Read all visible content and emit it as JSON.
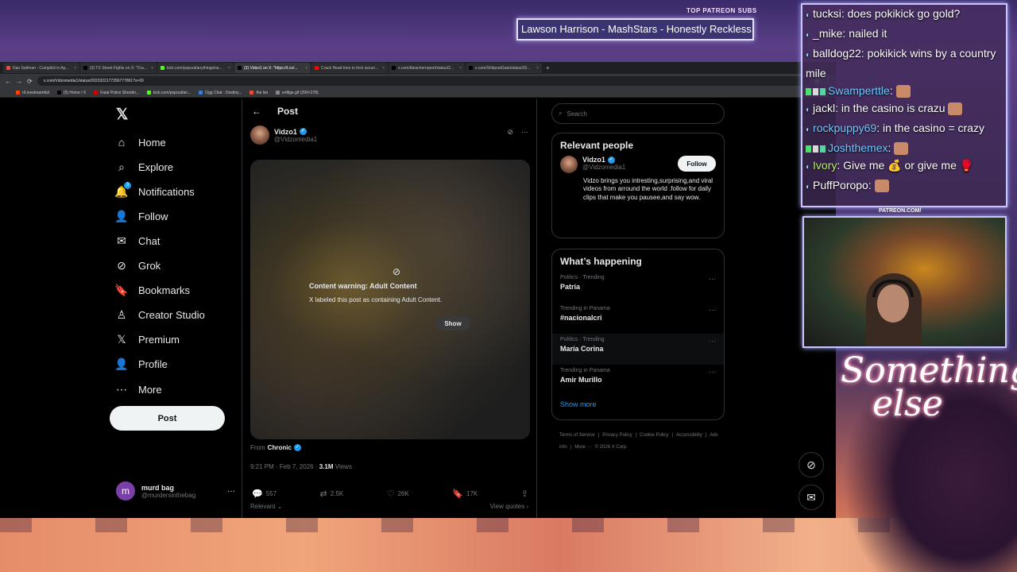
{
  "browser": {
    "tabs": [
      {
        "title": "Dan Saltman - Complicit in Ap...",
        "color": "#e74c3c",
        "active": false
      },
      {
        "title": "(3) TX Street Fights on X: \"Cra...",
        "color": "#000000",
        "active": false
      },
      {
        "title": "kick.com/popout/anythingelse...",
        "color": "#53fc18",
        "active": false
      },
      {
        "title": "(3) Vidzo1 on X: \"https://t.co/...",
        "color": "#000000",
        "active": true
      },
      {
        "title": "Crack Head tries to trick securi...",
        "color": "#ff0000",
        "active": false
      },
      {
        "title": "x.com/bleacherreport/status/2...",
        "color": "#000000",
        "active": false
      },
      {
        "title": "x.com/ShitpostGate/status/20...",
        "color": "#000000",
        "active": false
      }
    ],
    "new_tab": "+",
    "url": "x.com/Vidzomedia1/status/2020322177356777891?s=20",
    "bookmarks": [
      {
        "label": "r/Livestreamfail",
        "color": "#ff4500"
      },
      {
        "label": "(5) Home / X",
        "color": "#000000"
      },
      {
        "label": "Fatal Police Shootin...",
        "color": "#cc0000"
      },
      {
        "label": "kick.com/popout/an...",
        "color": "#53fc18"
      },
      {
        "label": "Ogg Chat - Destiny...",
        "color": "#3a7bd5"
      },
      {
        "label": "the list",
        "color": "#e74c3c"
      },
      {
        "label": "enfilge.gif (299×278)",
        "color": "#888888"
      }
    ]
  },
  "nav": {
    "logo": "𝕏",
    "items": [
      {
        "label": "Home",
        "icon": "⌂",
        "name": "home"
      },
      {
        "label": "Explore",
        "icon": "⌕",
        "name": "explore"
      },
      {
        "label": "Notifications",
        "icon": "🔔",
        "name": "notifications",
        "badge": "3"
      },
      {
        "label": "Follow",
        "icon": "👤",
        "name": "follow"
      },
      {
        "label": "Chat",
        "icon": "✉",
        "name": "chat"
      },
      {
        "label": "Grok",
        "icon": "⊘",
        "name": "grok"
      },
      {
        "label": "Bookmarks",
        "icon": "🔖",
        "name": "bookmarks"
      },
      {
        "label": "Creator Studio",
        "icon": "♙",
        "name": "creator-studio"
      },
      {
        "label": "Premium",
        "icon": "𝕏",
        "name": "premium"
      },
      {
        "label": "Profile",
        "icon": "👤",
        "name": "profile"
      },
      {
        "label": "More",
        "icon": "⋯",
        "name": "more"
      }
    ],
    "post_button": "Post",
    "account": {
      "initial": "m",
      "name": "murd bag",
      "handle": "@murdersinthebag",
      "more": "···"
    }
  },
  "post": {
    "header": "Post",
    "back": "←",
    "author_name": "Vidzo1",
    "author_handle": "@Vidzomedia1",
    "content_warning_title": "Content warning: Adult Content",
    "content_warning_text": "X labeled this post as containing Adult Content.",
    "show_label": "Show",
    "from_label": "From",
    "from_source": "Chronic",
    "time": "9:21 PM · Feb 7, 2026 ·",
    "views_count": "3.1M",
    "views_label": "Views",
    "actions": {
      "replies": "557",
      "reposts": "2.5K",
      "likes": "26K",
      "bookmarks": "17K"
    },
    "sort_label": "Relevant",
    "view_quotes": "View quotes"
  },
  "sidebar": {
    "search_placeholder": "Search",
    "relevant_people": {
      "title": "Relevant people",
      "name": "Vidzo1",
      "handle": "@Vidzomedia1",
      "follow": "Follow",
      "bio": "Vidzo brings you intresting,surprising,and viral videos from arround the world .follow for daily clips that make you pausee,and say wow."
    },
    "whats_happening": {
      "title": "What’s happening",
      "trends": [
        {
          "context": "Politics · Trending",
          "name": "Patria"
        },
        {
          "context": "Trending in Panama",
          "name": "#nacionalcri"
        },
        {
          "context": "Politics · Trending",
          "name": "María Corina"
        },
        {
          "context": "Trending in Panama",
          "name": "Amir Murillo"
        }
      ],
      "show_more": "Show more"
    },
    "footer": [
      "Terms of Service",
      "|",
      "Privacy Policy",
      "|",
      "Cookie Policy",
      "|",
      "Accessibility",
      "|",
      "Ads info",
      "|",
      "More ···",
      "© 2026 X Corp."
    ]
  },
  "overlay": {
    "patreon_label": "TOP PATREON SUBS",
    "ticker": "Lawson Harrison - MashStars - Honestly Reckless",
    "patreon_url": "PATREON.COM/",
    "signature_top": "Something",
    "signature_bottom": "else",
    "chat": [
      {
        "user": "tucksi",
        "text": "does pokikick go gold?",
        "style": ""
      },
      {
        "user": "_mike",
        "text": "nailed it",
        "style": ""
      },
      {
        "user": "balldog22",
        "text": "pokikick wins by a country mile",
        "style": ""
      },
      {
        "user": "Swamperttle",
        "text": "",
        "style": "c1",
        "badges": true,
        "emote": true
      },
      {
        "user": "jackl",
        "text": "in the casino is crazu",
        "style": "",
        "emote": true
      },
      {
        "user": "rockpuppy69",
        "text": "in the casino = crazy",
        "style": "c1"
      },
      {
        "user": "Joshthemex",
        "text": "",
        "style": "c1",
        "badges": true,
        "emote": true
      },
      {
        "user": "Ivory",
        "text": "Give me 💰 or give me 🥊",
        "style": "c2"
      },
      {
        "user": "PuffPoropo",
        "text": "",
        "style": "",
        "emote": true
      }
    ]
  },
  "colors": {
    "accent": "#1d9bf0",
    "bg": "#000000",
    "border": "#2f3336"
  }
}
